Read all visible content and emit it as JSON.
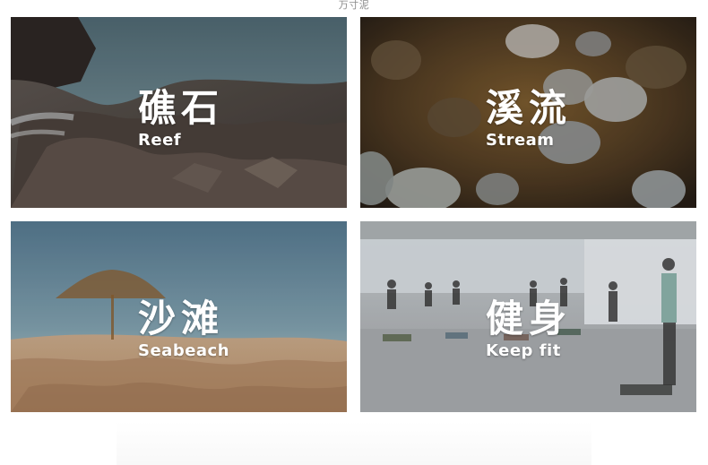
{
  "header": {
    "watermark": "万寸泥"
  },
  "tiles": [
    {
      "id": "reef",
      "title_cn": "礁石",
      "title_en": "Reef"
    },
    {
      "id": "stream",
      "title_cn": "溪流",
      "title_en": "Stream"
    },
    {
      "id": "seabeach",
      "title_cn": "沙滩",
      "title_en": "Seabeach"
    },
    {
      "id": "keepfit",
      "title_cn": "健身",
      "title_en": "Keep fit"
    }
  ]
}
